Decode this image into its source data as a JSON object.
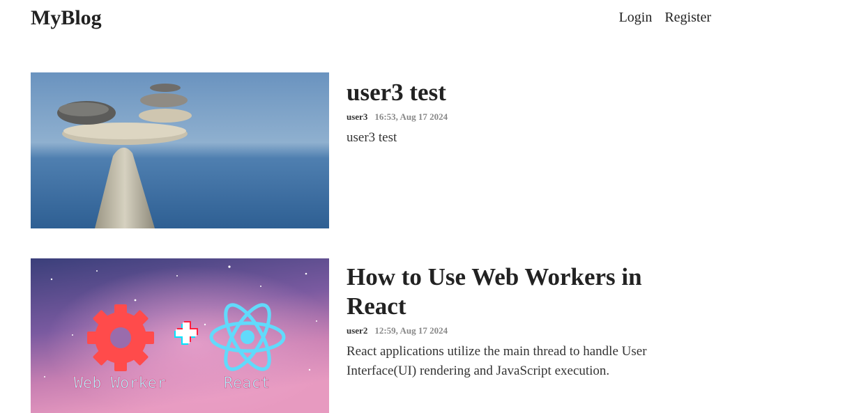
{
  "header": {
    "logo": "MyBlog",
    "nav": {
      "login": "Login",
      "register": "Register"
    }
  },
  "posts": [
    {
      "title": "user3 test",
      "author": "user3",
      "date": "16:53, Aug 17 2024",
      "summary": "user3 test",
      "image": {
        "description_icon": "balanced-stones-image"
      }
    },
    {
      "title": "How to Use Web Workers in React",
      "author": "user2",
      "date": "12:59, Aug 17 2024",
      "summary": "React applications utilize the main thread to handle User Interface(UI) rendering and JavaScript execution.",
      "image": {
        "description_icon": "web-worker-react-image",
        "left_caption": "Web Worker",
        "right_caption": "React"
      }
    }
  ]
}
